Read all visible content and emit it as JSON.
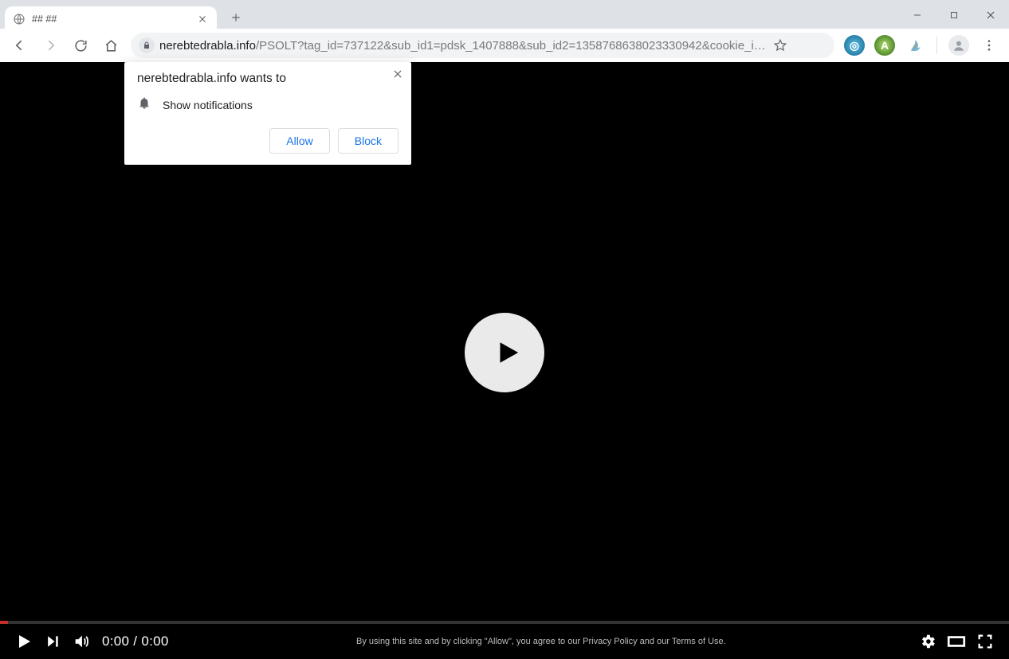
{
  "tab": {
    "title": "## ##"
  },
  "address": {
    "host": "nerebtedrabla.info",
    "path": "/PSOLT?tag_id=737122&sub_id1=pdsk_1407888&sub_id2=1358768638023330942&cookie_i…"
  },
  "permission": {
    "heading": "nerebtedrabla.info wants to",
    "request": "Show notifications",
    "allow": "Allow",
    "block": "Block"
  },
  "player": {
    "time": "0:00 / 0:00",
    "legal": "By using this site and by clicking \"Allow\", you agree to our Privacy Policy and our Terms of Use."
  }
}
